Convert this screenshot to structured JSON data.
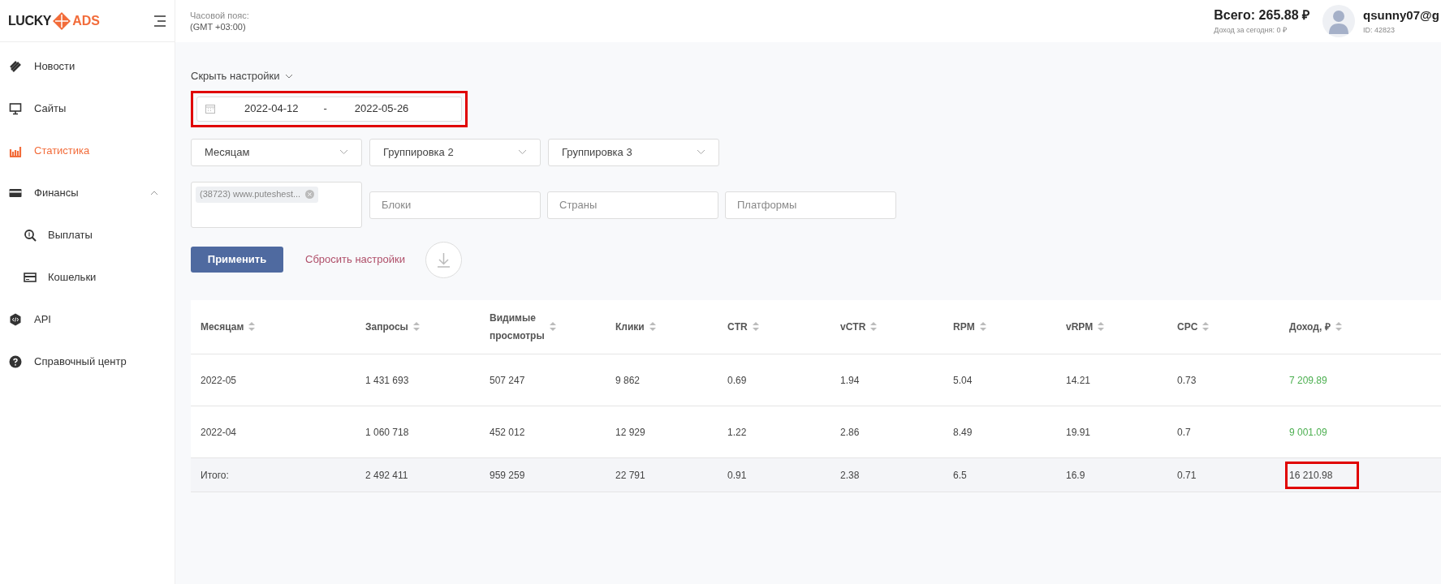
{
  "logo": {
    "left": "LUCKY",
    "right": "ADS"
  },
  "header": {
    "timezone_label": "Часовой пояс:",
    "timezone_value": "(GMT +03:00)",
    "balance": "Всего: 265.88 ₽",
    "today": "Доход за сегодня: 0 ₽",
    "user": "qsunny07@g",
    "user_id": "ID: 42823"
  },
  "sidebar": {
    "items": [
      {
        "label": "Новости",
        "kind": "news",
        "selected": false
      },
      {
        "label": "Сайты",
        "kind": "monitor",
        "selected": false
      },
      {
        "label": "Статистика",
        "kind": "chart",
        "selected": true
      },
      {
        "label": "Финансы",
        "kind": "card",
        "selected": false,
        "expanded": true,
        "children": [
          {
            "label": "Выплаты",
            "kind": "search",
            "selected": false
          },
          {
            "label": "Кошельки",
            "kind": "wallet",
            "selected": false
          }
        ]
      },
      {
        "label": "API",
        "kind": "api",
        "selected": false
      },
      {
        "label": "Справочный центр",
        "kind": "help",
        "selected": false
      }
    ]
  },
  "filters": {
    "toggle": "Скрыть настройки",
    "date_from": "2022-04-12",
    "date_separator": "-",
    "date_to": "2022-05-26",
    "date_highlighted": true,
    "groupings": [
      "Месяцам",
      "Группировка 2",
      "Группировка 3"
    ],
    "site_tags": [
      "(38723) www.puteshest..."
    ],
    "fields": [
      {
        "placeholder": "Блоки"
      },
      {
        "placeholder": "Страны"
      },
      {
        "placeholder": "Платформы"
      }
    ],
    "apply": "Применить",
    "reset": "Сбросить настройки"
  },
  "table": {
    "columns": [
      "Месяцам",
      "Запросы",
      "Видимые просмотры",
      "Клики",
      "CTR",
      "vCTR",
      "RPM",
      "vRPM",
      "CPC",
      "Доход, ₽"
    ],
    "rows": [
      [
        "2022-05",
        "1 431 693",
        "507 247",
        "9 862",
        "0.69",
        "1.94",
        "5.04",
        "14.21",
        "0.73",
        "7 209.89"
      ],
      [
        "2022-04",
        "1 060 718",
        "452 012",
        "12 929",
        "1.22",
        "2.86",
        "8.49",
        "19.91",
        "0.7",
        "9 001.09"
      ]
    ],
    "total": {
      "cells": [
        "Итого:",
        "2 492 411",
        "959 259",
        "22 791",
        "0.91",
        "2.38",
        "6.5",
        "16.9",
        "0.71",
        "16 210.98"
      ],
      "last_highlighted": true
    }
  }
}
